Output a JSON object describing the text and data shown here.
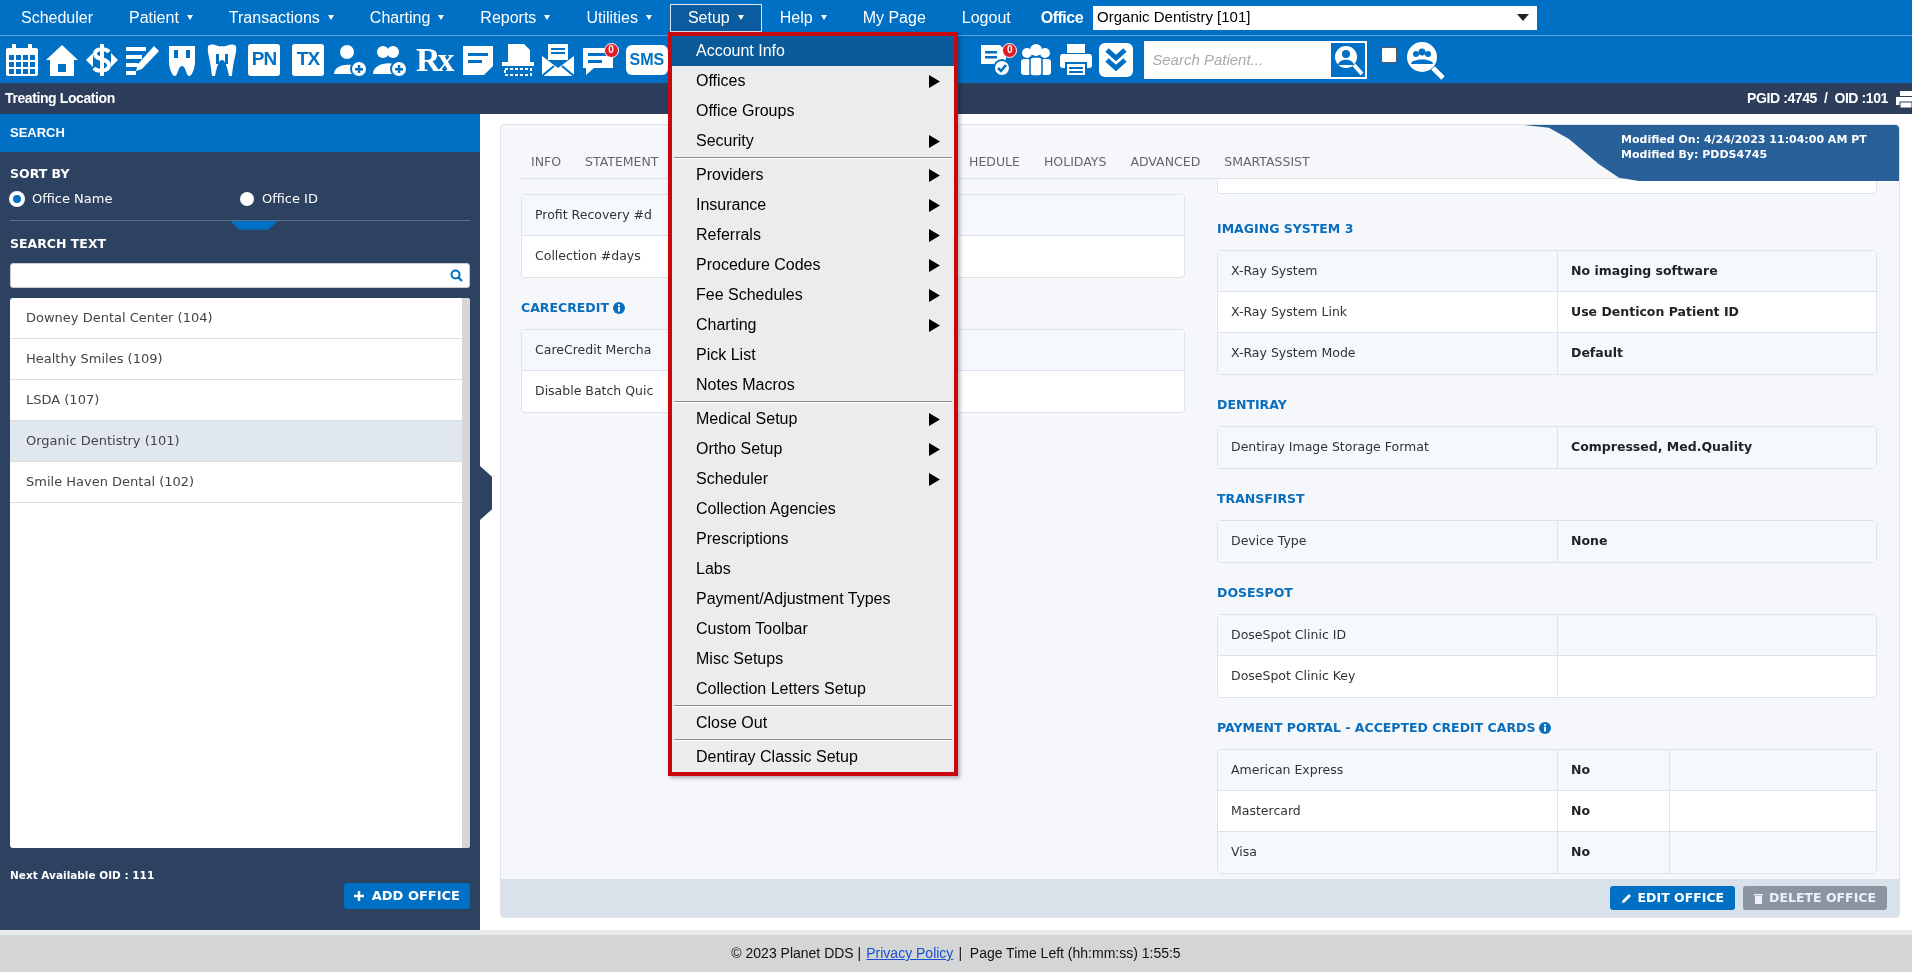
{
  "nav": {
    "items": [
      {
        "label": "Scheduler",
        "dropdown": false,
        "selected": false
      },
      {
        "label": "Patient",
        "dropdown": true,
        "selected": false
      },
      {
        "label": "Transactions",
        "dropdown": true,
        "selected": false
      },
      {
        "label": "Charting",
        "dropdown": true,
        "selected": false
      },
      {
        "label": "Reports",
        "dropdown": true,
        "selected": false
      },
      {
        "label": "Utilities",
        "dropdown": true,
        "selected": false
      },
      {
        "label": "Setup",
        "dropdown": true,
        "selected": true
      },
      {
        "label": "Help",
        "dropdown": true,
        "selected": false
      },
      {
        "label": "My Page",
        "dropdown": false,
        "selected": false
      },
      {
        "label": "Logout",
        "dropdown": false,
        "selected": false
      }
    ],
    "office_label": "Office",
    "office_select": "Organic Dentistry [101]"
  },
  "toolbar": {
    "left": [
      {
        "kind": "calendar"
      },
      {
        "kind": "home"
      },
      {
        "kind": "dollar"
      },
      {
        "kind": "edit"
      },
      {
        "kind": "tooth"
      },
      {
        "kind": "tooth-root"
      },
      {
        "kind": "tile",
        "text": "PN"
      },
      {
        "kind": "tile",
        "text": "TX"
      },
      {
        "kind": "user-plus"
      },
      {
        "kind": "users-plus"
      },
      {
        "kind": "rx",
        "text": "Rx"
      },
      {
        "kind": "note"
      },
      {
        "kind": "scan"
      },
      {
        "kind": "mail"
      },
      {
        "kind": "chat",
        "badge": "0"
      },
      {
        "kind": "sms",
        "text": "SMS"
      }
    ],
    "right": [
      {
        "kind": "doc-check",
        "badge": "0"
      },
      {
        "kind": "group"
      },
      {
        "kind": "printer"
      },
      {
        "kind": "chevrons"
      }
    ],
    "search": {
      "placeholder": "Search Patient..."
    },
    "show_all_checked": false
  },
  "location_bar": {
    "title": "Treating Location",
    "ids": "PGID :4745  /  OID :101"
  },
  "setup_menu": {
    "groups": [
      [
        {
          "label": "Account Info",
          "has_submenu": false,
          "selected": true
        },
        {
          "label": "Offices",
          "has_submenu": true,
          "selected": false
        },
        {
          "label": "Office Groups",
          "has_submenu": false,
          "selected": false
        },
        {
          "label": "Security",
          "has_submenu": true,
          "selected": false
        }
      ],
      [
        {
          "label": "Providers",
          "has_submenu": true,
          "selected": false
        },
        {
          "label": "Insurance",
          "has_submenu": true,
          "selected": false
        },
        {
          "label": "Referrals",
          "has_submenu": true,
          "selected": false
        },
        {
          "label": "Procedure Codes",
          "has_submenu": true,
          "selected": false
        },
        {
          "label": "Fee Schedules",
          "has_submenu": true,
          "selected": false
        },
        {
          "label": "Charting",
          "has_submenu": true,
          "selected": false
        },
        {
          "label": "Pick List",
          "has_submenu": false,
          "selected": false
        },
        {
          "label": "Notes Macros",
          "has_submenu": false,
          "selected": false
        }
      ],
      [
        {
          "label": "Medical Setup",
          "has_submenu": true,
          "selected": false
        },
        {
          "label": "Ortho Setup",
          "has_submenu": true,
          "selected": false
        },
        {
          "label": "Scheduler",
          "has_submenu": true,
          "selected": false
        },
        {
          "label": "Collection Agencies",
          "has_submenu": false,
          "selected": false
        },
        {
          "label": "Prescriptions",
          "has_submenu": false,
          "selected": false
        },
        {
          "label": "Labs",
          "has_submenu": false,
          "selected": false
        },
        {
          "label": "Payment/Adjustment Types",
          "has_submenu": false,
          "selected": false
        },
        {
          "label": "Custom Toolbar",
          "has_submenu": false,
          "selected": false
        },
        {
          "label": "Misc Setups",
          "has_submenu": false,
          "selected": false
        },
        {
          "label": "Collection Letters Setup",
          "has_submenu": false,
          "selected": false
        }
      ],
      [
        {
          "label": "Close Out",
          "has_submenu": false,
          "selected": false
        }
      ],
      [
        {
          "label": "Dentiray Classic Setup",
          "has_submenu": false,
          "selected": false
        }
      ]
    ]
  },
  "sidebar": {
    "title": "SEARCH",
    "sort_label": "SORT BY",
    "sort_options": [
      {
        "label": "Office Name",
        "selected": true
      },
      {
        "label": "Office ID",
        "selected": false
      }
    ],
    "search_label": "SEARCH TEXT",
    "offices": [
      {
        "label": "Downey Dental Center (104)",
        "selected": false
      },
      {
        "label": "Healthy Smiles (109)",
        "selected": false
      },
      {
        "label": "LSDA (107)",
        "selected": false
      },
      {
        "label": "Organic Dentistry (101)",
        "selected": true
      },
      {
        "label": "Smile Haven Dental (102)",
        "selected": false
      }
    ],
    "next_oid": "Next Available OID : 111",
    "add_button": "ADD OFFICE"
  },
  "main": {
    "tabs_left": [
      {
        "label": "INFO"
      },
      {
        "label": "STATEMENT"
      }
    ],
    "tabs_right": [
      {
        "label": "HEDULE"
      },
      {
        "label": "HOLIDAYS"
      },
      {
        "label": "ADVANCED"
      },
      {
        "label": "SMARTASSIST"
      }
    ],
    "modified_on": "Modified On: 4/24/2023 11:04:00 AM PT",
    "modified_by": "Modified By: PDDS4745",
    "left_sections": [
      {
        "rows": [
          {
            "label": "Profit Recovery #d"
          },
          {
            "label": "Collection #days"
          }
        ]
      },
      {
        "title": "CARECREDIT",
        "info": true,
        "rows": [
          {
            "label": "CareCredit Mercha"
          },
          {
            "label": "Disable Batch Quic"
          }
        ]
      }
    ],
    "right_sections": [
      {
        "title": "IMAGING SYSTEM 3",
        "info": false,
        "rows": [
          {
            "label": "X-Ray System",
            "value": "No imaging software"
          },
          {
            "label": "X-Ray System Link",
            "value": "Use Denticon Patient ID"
          },
          {
            "label": "X-Ray System Mode",
            "value": "Default"
          }
        ]
      },
      {
        "title": "DENTIRAY",
        "info": false,
        "rows": [
          {
            "label": "Dentiray Image Storage Format",
            "value": "Compressed, Med.Quality"
          }
        ]
      },
      {
        "title": "TRANSFIRST",
        "info": false,
        "rows": [
          {
            "label": "Device Type",
            "value": "None"
          }
        ]
      },
      {
        "title": "DOSESPOT",
        "info": false,
        "rows": [
          {
            "label": "DoseSpot Clinic ID"
          },
          {
            "label": "DoseSpot Clinic Key"
          }
        ]
      },
      {
        "title": "PAYMENT PORTAL - ACCEPTED CREDIT CARDS",
        "info": true,
        "extra_blank_column": true,
        "rows": [
          {
            "label": "American Express",
            "value": "No"
          },
          {
            "label": "Mastercard",
            "value": "No"
          },
          {
            "label": "Visa",
            "value": "No"
          }
        ]
      }
    ],
    "buttons": [
      {
        "kind": "edit",
        "label": "EDIT OFFICE",
        "disabled": false
      },
      {
        "kind": "delete",
        "label": "DELETE OFFICE",
        "disabled": true
      }
    ]
  },
  "footer": {
    "copyright": "© 2023 Planet DDS |",
    "link": "Privacy Policy",
    "time": "|  Page Time Left (hh:mm:ss) 1:55:5"
  }
}
